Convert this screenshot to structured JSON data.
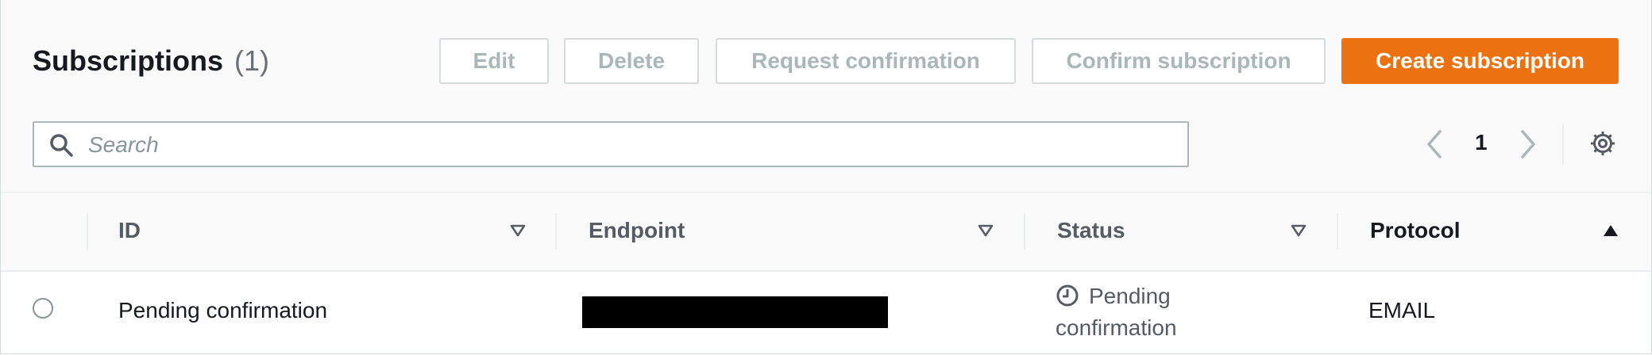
{
  "header": {
    "title": "Subscriptions",
    "count": "(1)",
    "buttons": {
      "edit": "Edit",
      "delete": "Delete",
      "request_confirmation": "Request confirmation",
      "confirm_subscription": "Confirm subscription",
      "create_subscription": "Create subscription"
    }
  },
  "search": {
    "placeholder": "Search",
    "value": ""
  },
  "pagination": {
    "current_page": "1"
  },
  "table": {
    "columns": [
      "ID",
      "Endpoint",
      "Status",
      "Protocol"
    ],
    "sort": {
      "column": "Protocol",
      "direction": "ascending"
    },
    "rows": [
      {
        "id": "Pending confirmation",
        "endpoint": "",
        "status": "Pending confirmation",
        "protocol": "EMAIL"
      }
    ]
  },
  "colors": {
    "primary": "#ec7211",
    "disabled_text": "#aab7b8",
    "border": "#d5dbdb",
    "header_bg": "#fafafa"
  },
  "icons": [
    "search-icon",
    "chevron-left-icon",
    "chevron-right-icon",
    "gear-icon",
    "sort-triangle-icon",
    "clock-icon"
  ]
}
